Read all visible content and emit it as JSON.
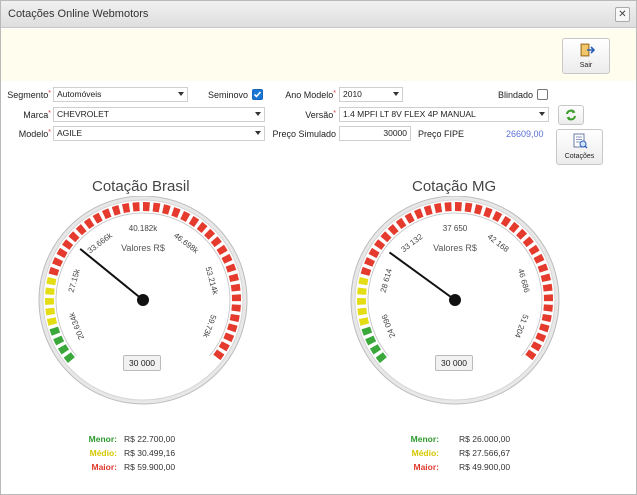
{
  "window": {
    "title": "Cotações Online Webmotors",
    "close_symbol": "✕"
  },
  "buttons": {
    "sair": "Sair",
    "cotacoes": "Cotações"
  },
  "form": {
    "segmento_label": "Segmento",
    "segmento_value": "Automóveis",
    "seminovo_label": "Seminovo",
    "seminovo_checked": true,
    "ano_label": "Ano Modelo",
    "ano_value": "2010",
    "blindado_label": "Blindado",
    "blindado_checked": false,
    "marca_label": "Marca",
    "marca_value": "CHEVROLET",
    "versao_label": "Versão",
    "versao_value": "1.4 MPFI LT 8V FLEX 4P MANUAL",
    "modelo_label": "Modelo",
    "modelo_value": "AGILE",
    "preco_simulado_label": "Preço Simulado",
    "preco_simulado_value": "30000",
    "preco_fipe_label": "Preço FIPE",
    "preco_fipe_value": "26609,00"
  },
  "gauges": [
    {
      "title": "Cotação Brasil",
      "subtitle": "Valores R$",
      "display_value": "30 000",
      "ticks": [
        "20.634k",
        "27.15k",
        "33.666k",
        "40.182k",
        "46.698k",
        "53.214k",
        "59.73k"
      ],
      "min": 16000,
      "max": 62000,
      "needle": 30000,
      "stats": [
        {
          "label": "Menor:",
          "value": "R$ 22.700,00",
          "color": "#2e9a2e"
        },
        {
          "label": "Médio:",
          "value": "R$ 30.499,16",
          "color": "#d6c800"
        },
        {
          "label": "Maior:",
          "value": "R$ 59.900,00",
          "color": "#e03a2e"
        }
      ]
    },
    {
      "title": "Cotação MG",
      "subtitle": "Valores R$",
      "display_value": "30 000",
      "ticks": [
        "24 096",
        "28 614",
        "33 132",
        "37 650",
        "42 168",
        "46 686",
        "51 204"
      ],
      "min": 20500,
      "max": 53000,
      "needle": 30000,
      "stats": [
        {
          "label": "Menor:",
          "value": "R$ 26.000,00",
          "color": "#2e9a2e"
        },
        {
          "label": "Médio:",
          "value": "R$ 27.566,67",
          "color": "#d6c800"
        },
        {
          "label": "Maior:",
          "value": "R$ 49.900,00",
          "color": "#e03a2e"
        }
      ]
    }
  ],
  "colors": {
    "green": "#3aa83a",
    "yellow": "#e4dc14",
    "red": "#e53a2e",
    "fipe": "#5b6fd6"
  }
}
